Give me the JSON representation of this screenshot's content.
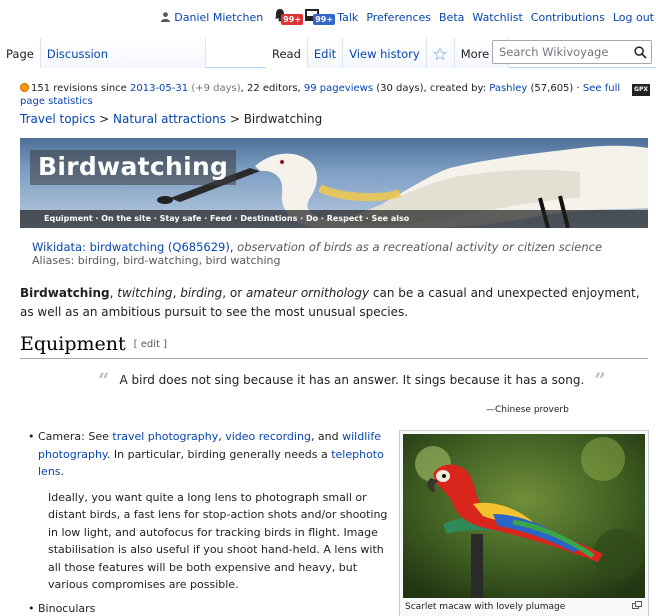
{
  "personal": {
    "user": "Daniel Mietchen",
    "alerts_badge": "99+",
    "notices_badge": "99+",
    "links": [
      "Talk",
      "Preferences",
      "Beta",
      "Watchlist",
      "Contributions",
      "Log out"
    ]
  },
  "tabs": {
    "page": "Page",
    "discussion": "Discussion",
    "read": "Read",
    "edit": "Edit",
    "history": "View history",
    "more": "More"
  },
  "search": {
    "placeholder": "Search Wikivoyage"
  },
  "info": {
    "revisions": "151 revisions since ",
    "date": "2013-05-31",
    "days": "(+9 days)",
    "editors": ", 22 editors, ",
    "pageviews": "99 pageviews",
    "pv_rest": " (30 days), created by: ",
    "creator": "Pashley",
    "creator_count": " (57,605)",
    "sep": " · ",
    "full_stats": "See full page statistics",
    "gpx": "GPX"
  },
  "breadcrumb": {
    "item1": "Travel topics",
    "sep": " > ",
    "item2": "Natural attractions",
    "current": "Birdwatching"
  },
  "banner": {
    "title": "Birdwatching",
    "nav": [
      "Equipment",
      "On the site",
      "Stay safe",
      "Feed",
      "Destinations",
      "Do",
      "Respect",
      "See also"
    ]
  },
  "wikidata": {
    "link": "Wikidata: birdwatching (Q685629)",
    "desc": "observation of birds as a recreational activity or citizen science",
    "aliases": "Aliases: birding, bird-watching, bird watching"
  },
  "intro": {
    "b": "Birdwatching",
    "t1": ", ",
    "i1": "twitching",
    "t2": ", ",
    "i2": "birding",
    "t3": ", or ",
    "i3": "amateur ornithology",
    "t4": " can be a casual and unexpected enjoyment, as well as an ambitious pursuit to see the most unusual species."
  },
  "section": {
    "title": "Equipment",
    "edit": "[ edit ]"
  },
  "quote": {
    "text": "A bird does not sing because it has an answer. It sings because it has a song.",
    "open": "“",
    "close": "”",
    "source": "—Chinese proverb"
  },
  "list": {
    "camera_pre": "Camera: See ",
    "travel_photo": "travel photography",
    "c1": ", ",
    "video": "video recording",
    "c2": ", and ",
    "wildlife": "wildlife photography",
    "camera_mid": ". In particular, birding generally needs a ",
    "tele": "telephoto lens",
    "camera_end": ".",
    "para": "Ideally, you want quite a long lens to photograph small or distant birds, a fast lens for stop-action shots and/or shooting in low light, and autofocus for tracking birds in flight. Image stabilisation is also useful if you shoot hand-held. A lens with all those features will be both expensive and heavy, but various compromises are possible.",
    "binoculars": "Binoculars"
  },
  "thumb": {
    "caption": "Scarlet macaw with lovely plumage"
  }
}
